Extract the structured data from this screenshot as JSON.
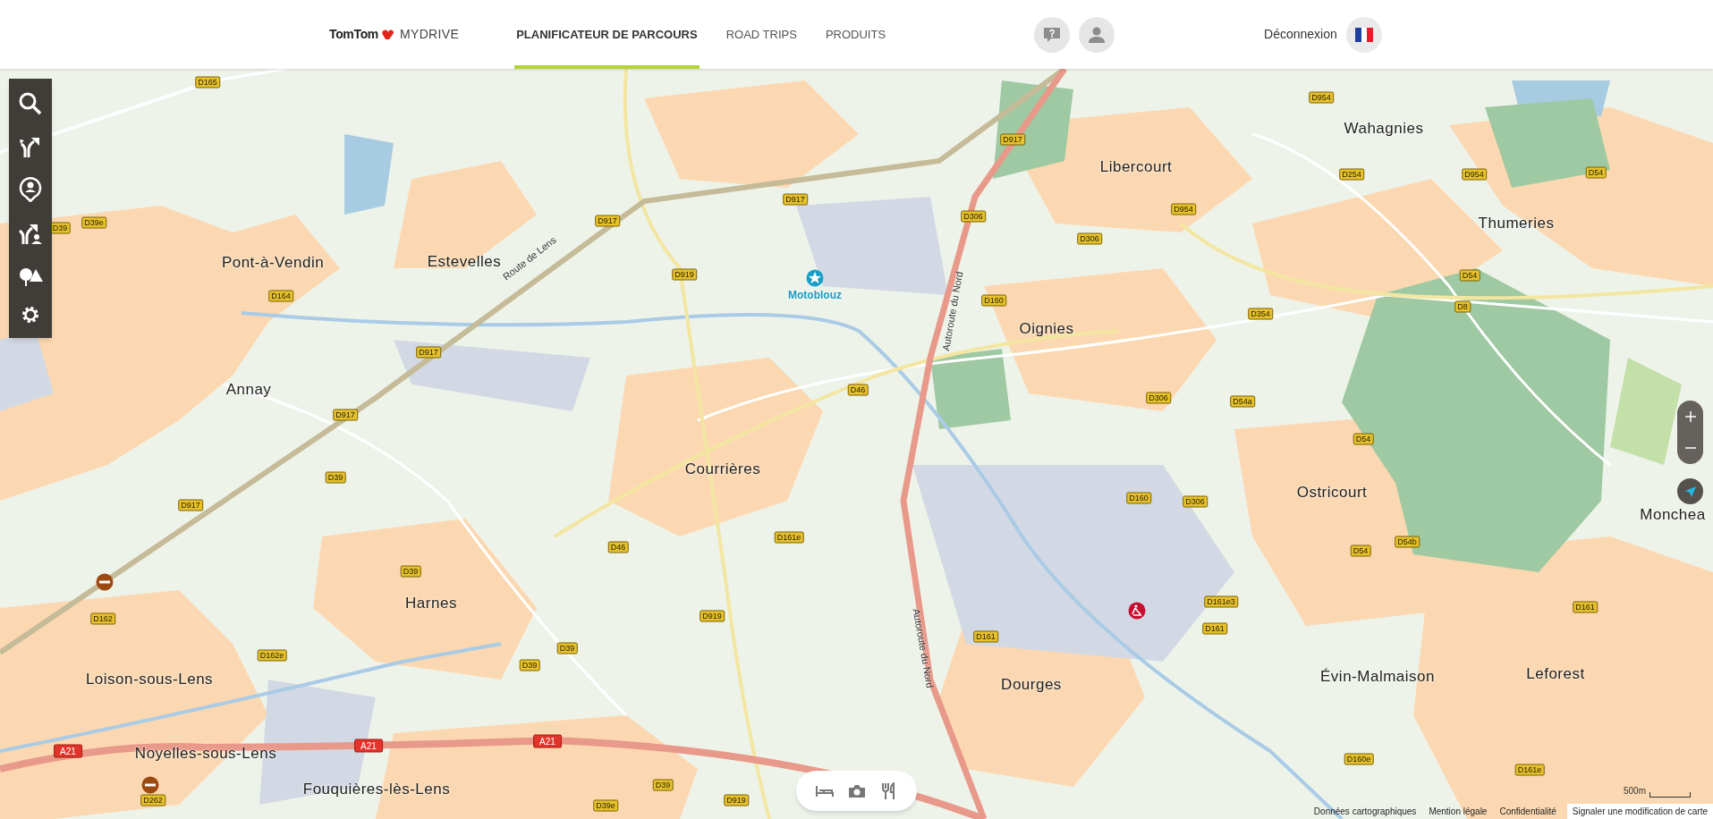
{
  "header": {
    "logo": {
      "brand": "TomTom",
      "product": "MYDRIVE"
    },
    "nav": [
      {
        "label": "PLANIFICATEUR DE PARCOURS",
        "selected": true
      },
      {
        "label": "ROAD TRIPS",
        "selected": false
      },
      {
        "label": "PRODUITS",
        "selected": false
      }
    ],
    "logout": "Déconnexion"
  },
  "map": {
    "places": [
      "Pont-à-Vendin",
      "Estevelles",
      "Annay",
      "Courrières",
      "Harnes",
      "Loison-sous-Lens",
      "Noyelles-sous-Lens",
      "Fouquières-lès-Lens",
      "Libercourt",
      "Wahagnies",
      "Thumeries",
      "Oignies",
      "Ostricourt",
      "Monchea",
      "Dourges",
      "Évin-Malmaison",
      "Leforest"
    ],
    "poi": {
      "label": "Motoblouz"
    },
    "road_names": [
      "Route de Lens",
      "Autoroute du Nord",
      "Autoroute du Nord"
    ],
    "road_shields": [
      {
        "label": "D165",
        "kind": "road"
      },
      {
        "label": "D917",
        "kind": "road"
      },
      {
        "label": "D917",
        "kind": "road"
      },
      {
        "label": "D917",
        "kind": "road"
      },
      {
        "label": "D917",
        "kind": "road"
      },
      {
        "label": "D917",
        "kind": "road"
      },
      {
        "label": "D917",
        "kind": "road"
      },
      {
        "label": "D954",
        "kind": "road"
      },
      {
        "label": "D254",
        "kind": "road"
      },
      {
        "label": "D954",
        "kind": "road"
      },
      {
        "label": "D54",
        "kind": "road"
      },
      {
        "label": "D306",
        "kind": "road"
      },
      {
        "label": "D306",
        "kind": "road"
      },
      {
        "label": "D954",
        "kind": "road"
      },
      {
        "label": "D160",
        "kind": "road"
      },
      {
        "label": "D354",
        "kind": "road"
      },
      {
        "label": "D54",
        "kind": "road"
      },
      {
        "label": "D8",
        "kind": "road"
      },
      {
        "label": "D919",
        "kind": "road"
      },
      {
        "label": "D164",
        "kind": "road"
      },
      {
        "label": "D39",
        "kind": "road"
      },
      {
        "label": "D39e",
        "kind": "road"
      },
      {
        "label": "D46",
        "kind": "road"
      },
      {
        "label": "D306",
        "kind": "road"
      },
      {
        "label": "D54a",
        "kind": "road"
      },
      {
        "label": "D54",
        "kind": "road"
      },
      {
        "label": "D39",
        "kind": "road"
      },
      {
        "label": "D160",
        "kind": "road"
      },
      {
        "label": "D306",
        "kind": "road"
      },
      {
        "label": "D161e",
        "kind": "road"
      },
      {
        "label": "D54b",
        "kind": "road"
      },
      {
        "label": "D54",
        "kind": "road"
      },
      {
        "label": "D46",
        "kind": "road"
      },
      {
        "label": "D39",
        "kind": "road"
      },
      {
        "label": "D161",
        "kind": "road"
      },
      {
        "label": "D162",
        "kind": "road"
      },
      {
        "label": "D919",
        "kind": "road"
      },
      {
        "label": "D161e3",
        "kind": "road"
      },
      {
        "label": "D161",
        "kind": "road"
      },
      {
        "label": "D161",
        "kind": "road"
      },
      {
        "label": "D162e",
        "kind": "road"
      },
      {
        "label": "D39",
        "kind": "road"
      },
      {
        "label": "D39",
        "kind": "road"
      },
      {
        "label": "A21",
        "kind": "motorway"
      },
      {
        "label": "A21",
        "kind": "motorway"
      },
      {
        "label": "A21",
        "kind": "motorway"
      },
      {
        "label": "D262",
        "kind": "road"
      },
      {
        "label": "D39",
        "kind": "road"
      },
      {
        "label": "D39e",
        "kind": "road"
      },
      {
        "label": "D919",
        "kind": "road"
      },
      {
        "label": "D160e",
        "kind": "road"
      },
      {
        "label": "D161e",
        "kind": "road"
      }
    ]
  },
  "scale": "500m",
  "footer_links": [
    "Données cartographiques",
    "Mention légale",
    "Confidentialité",
    "Signaler une modification de carte"
  ]
}
